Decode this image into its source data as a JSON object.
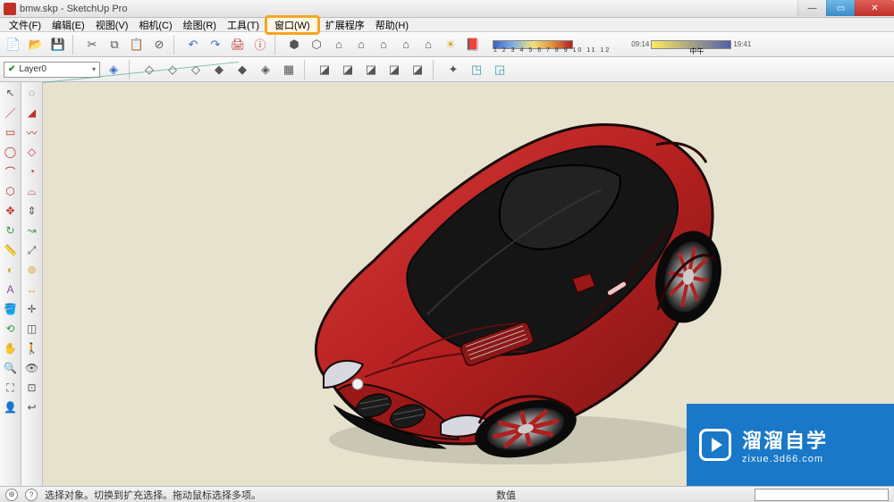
{
  "title": "bmw.skp - SketchUp Pro",
  "window_controls": {
    "min": "—",
    "max": "▭",
    "close": "✕"
  },
  "menu": [
    {
      "label": "文件(F)"
    },
    {
      "label": "编辑(E)"
    },
    {
      "label": "视图(V)"
    },
    {
      "label": "相机(C)"
    },
    {
      "label": "绘图(R)"
    },
    {
      "label": "工具(T)"
    },
    {
      "label": "窗口(W)",
      "highlighted": true
    },
    {
      "label": "扩展程序"
    },
    {
      "label": "帮助(H)"
    }
  ],
  "toolbar1_icons": [
    "new-file",
    "open-file",
    "save",
    "cut",
    "copy",
    "paste",
    "delete",
    "undo",
    "redo",
    "print",
    "model-info",
    "sep",
    "warehouse",
    "component",
    "house",
    "house-front",
    "house-side",
    "house-back",
    "bulb",
    "book-red"
  ],
  "scale1": {
    "ticks": "1 2 3 4 5 6 7 8 9 10 11 12"
  },
  "scale2": {
    "left": "09:14",
    "mid": "中午",
    "right": "19:41"
  },
  "layer": {
    "name": "Layer0",
    "checked": true
  },
  "toolbar2_icons": [
    "layer-mgr",
    "sep",
    "xray",
    "wire",
    "hidden",
    "shaded",
    "shaded-tex",
    "mono",
    "style-edit",
    "sep",
    "section-plane",
    "section-display",
    "section-cut",
    "section-fill",
    "section-group",
    "sep",
    "axis-orbit",
    "iso-1",
    "iso-2"
  ],
  "left_tools_col1": [
    "select",
    "eraser",
    "line",
    "rect",
    "circle",
    "arc",
    "freehand",
    "move",
    "rotate",
    "scale",
    "offset",
    "tape",
    "protractor",
    "text",
    "paint",
    "orbit",
    "pan",
    "zoom",
    "zoom-ext",
    "walk",
    "look",
    "person"
  ],
  "left_tools_col2": [
    "lasso",
    "eraser-soft",
    "polyline",
    "rotated-rect",
    "polygon",
    "pie",
    "arc2",
    "pushpull",
    "followme",
    "scale2",
    "offset2",
    "dims",
    "axes",
    "label",
    "sample",
    "position-cam",
    "prev-view",
    "zoom-win",
    "zoom-sel",
    "section"
  ],
  "status": {
    "text": "选择对象。切换到扩充选择。拖动鼠标选择多项。",
    "num_label": "数值"
  },
  "watermark": {
    "brand": "溜溜自学",
    "url": "zixue.3d66.com"
  }
}
